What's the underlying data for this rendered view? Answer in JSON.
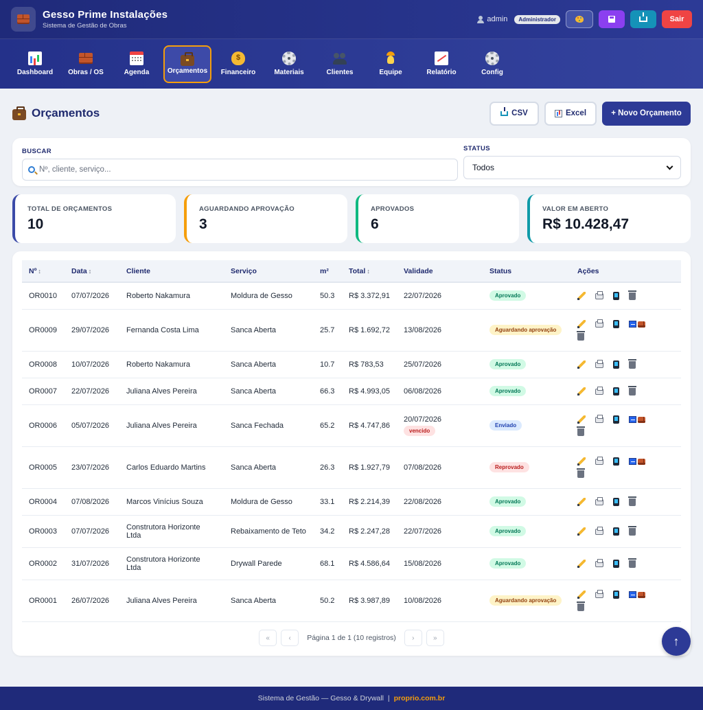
{
  "brand": {
    "title": "Gesso Prime Instalações",
    "subtitle": "Sistema de Gestão de Obras"
  },
  "user": {
    "name": "admin",
    "role": "Administrador",
    "exit_label": "Sair"
  },
  "nav": [
    {
      "label": "Dashboard",
      "icon": "chart-icon"
    },
    {
      "label": "Obras / OS",
      "icon": "brick-icon"
    },
    {
      "label": "Agenda",
      "icon": "calendar-icon"
    },
    {
      "label": "Orçamentos",
      "icon": "briefcase-icon",
      "active": true
    },
    {
      "label": "Financeiro",
      "icon": "money-bag-icon"
    },
    {
      "label": "Materiais",
      "icon": "gear-icon"
    },
    {
      "label": "Clientes",
      "icon": "people-icon"
    },
    {
      "label": "Equipe",
      "icon": "worker-icon"
    },
    {
      "label": "Relatório",
      "icon": "line-chart-icon"
    },
    {
      "label": "Config",
      "icon": "gear-icon"
    }
  ],
  "page": {
    "title": "Orçamentos",
    "csv_label": "CSV",
    "excel_label": "Excel",
    "new_label": "+ Novo Orçamento"
  },
  "filters": {
    "search_label": "BUSCAR",
    "search_placeholder": "Nº, cliente, serviço...",
    "status_label": "STATUS",
    "status_value": "Todos"
  },
  "stats": [
    {
      "label": "TOTAL DE ORÇAMENTOS",
      "value": "10"
    },
    {
      "label": "AGUARDANDO APROVAÇÃO",
      "value": "3"
    },
    {
      "label": "APROVADOS",
      "value": "6"
    },
    {
      "label": "VALOR EM ABERTO",
      "value": "R$ 10.428,47"
    }
  ],
  "table": {
    "columns": [
      "Nº",
      "Data",
      "Cliente",
      "Serviço",
      "m²",
      "Total",
      "Validade",
      "Status",
      "Ações"
    ],
    "sort_glyph": "↕",
    "expired_label": "vencido",
    "rows": [
      {
        "num": "OR0010",
        "date": "07/07/2026",
        "client": "Roberto Nakamura",
        "service": "Moldura de Gesso",
        "m2": "50.3",
        "total": "R$ 3.372,91",
        "validity": "22/07/2026",
        "status": "Aprovado"
      },
      {
        "num": "OR0009",
        "date": "29/07/2026",
        "client": "Fernanda Costa Lima",
        "service": "Sanca Aberta",
        "m2": "25.7",
        "total": "R$ 1.692,72",
        "validity": "13/08/2026",
        "status": "Aguardando aprovação"
      },
      {
        "num": "OR0008",
        "date": "10/07/2026",
        "client": "Roberto Nakamura",
        "service": "Sanca Aberta",
        "m2": "10.7",
        "total": "R$ 783,53",
        "validity": "25/07/2026",
        "status": "Aprovado"
      },
      {
        "num": "OR0007",
        "date": "22/07/2026",
        "client": "Juliana Alves Pereira",
        "service": "Sanca Aberta",
        "m2": "66.3",
        "total": "R$ 4.993,05",
        "validity": "06/08/2026",
        "status": "Aprovado"
      },
      {
        "num": "OR0006",
        "date": "05/07/2026",
        "client": "Juliana Alves Pereira",
        "service": "Sanca Fechada",
        "m2": "65.2",
        "total": "R$ 4.747,86",
        "validity": "20/07/2026",
        "status": "Enviado",
        "expired": true
      },
      {
        "num": "OR0005",
        "date": "23/07/2026",
        "client": "Carlos Eduardo Martins",
        "service": "Sanca Aberta",
        "m2": "26.3",
        "total": "R$ 1.927,79",
        "validity": "07/08/2026",
        "status": "Reprovado"
      },
      {
        "num": "OR0004",
        "date": "07/08/2026",
        "client": "Marcos Vinícius Souza",
        "service": "Moldura de Gesso",
        "m2": "33.1",
        "total": "R$ 2.214,39",
        "validity": "22/08/2026",
        "status": "Aprovado"
      },
      {
        "num": "OR0003",
        "date": "07/07/2026",
        "client": "Construtora Horizonte Ltda",
        "service": "Rebaixamento de Teto",
        "m2": "34.2",
        "total": "R$ 2.247,28",
        "validity": "22/07/2026",
        "status": "Aprovado"
      },
      {
        "num": "OR0002",
        "date": "31/07/2026",
        "client": "Construtora Horizonte Ltda",
        "service": "Drywall Parede",
        "m2": "68.1",
        "total": "R$ 4.586,64",
        "validity": "15/08/2026",
        "status": "Aprovado"
      },
      {
        "num": "OR0001",
        "date": "26/07/2026",
        "client": "Juliana Alves Pereira",
        "service": "Sanca Aberta",
        "m2": "50.2",
        "total": "R$ 3.987,89",
        "validity": "10/08/2026",
        "status": "Aguardando aprovação"
      }
    ]
  },
  "pagination": {
    "first": "«",
    "prev": "‹",
    "text": "Página 1 de 1 (10 registros)",
    "next": "›",
    "last": "»"
  },
  "fab": {
    "label": "↑"
  },
  "footer": {
    "text": "Sistema de Gestão — Gesso & Drywall",
    "separator": "|",
    "link": "proprio.com.br"
  },
  "colors": {
    "primary": "#2d3a96",
    "header": "#1f2a7a",
    "accent": "#f59e0b",
    "danger": "#ef4444"
  }
}
